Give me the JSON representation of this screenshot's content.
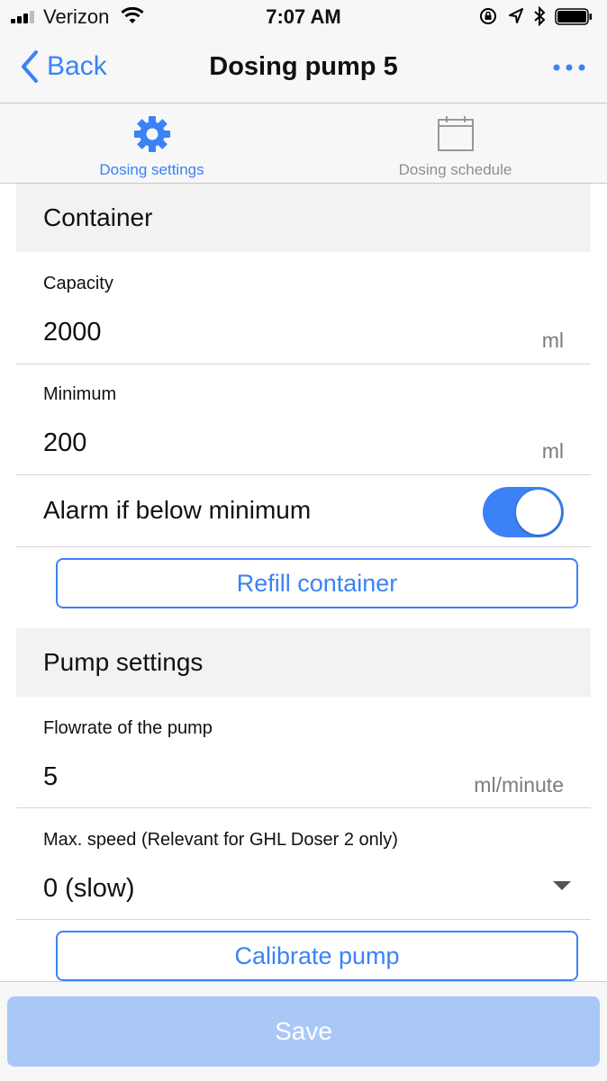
{
  "status_bar": {
    "carrier": "Verizon",
    "time": "7:07 AM"
  },
  "nav": {
    "back_label": "Back",
    "title": "Dosing pump 5"
  },
  "tabs": [
    {
      "label": "Dosing settings",
      "icon": "gear-icon",
      "active": true
    },
    {
      "label": "Dosing schedule",
      "icon": "calendar-icon",
      "active": false
    }
  ],
  "container": {
    "header": "Container",
    "capacity_label": "Capacity",
    "capacity_value": "2000",
    "capacity_unit": "ml",
    "minimum_label": "Minimum",
    "minimum_value": "200",
    "minimum_unit": "ml",
    "alarm_label": "Alarm if below minimum",
    "alarm_on": true,
    "refill_button": "Refill container"
  },
  "pump": {
    "header": "Pump settings",
    "flowrate_label": "Flowrate of the pump",
    "flowrate_value": "5",
    "flowrate_unit": "ml/minute",
    "maxspeed_label": "Max. speed (Relevant for GHL Doser 2 only)",
    "maxspeed_value": "0 (slow)",
    "calibrate_button": "Calibrate pump"
  },
  "footer": {
    "save_label": "Save"
  },
  "colors": {
    "accent": "#3b82f6",
    "save_disabled": "#a9c8f7"
  }
}
